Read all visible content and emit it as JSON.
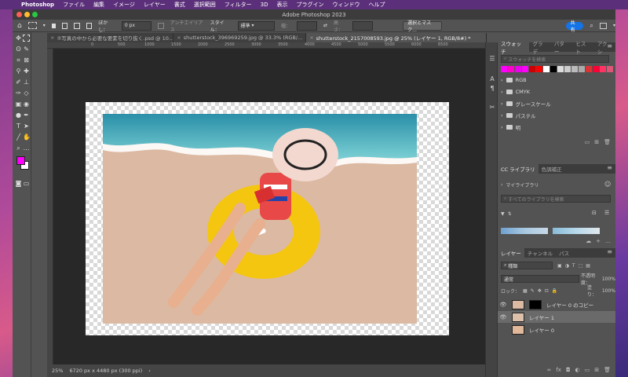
{
  "menubar": {
    "apple": "",
    "items": [
      "Photoshop",
      "ファイル",
      "編集",
      "イメージ",
      "レイヤー",
      "書式",
      "選択範囲",
      "フィルター",
      "3D",
      "表示",
      "プラグイン",
      "ウィンドウ",
      "ヘルプ"
    ]
  },
  "window": {
    "title": "Adobe Photoshop 2023"
  },
  "options": {
    "feather_label": "ぼかし：",
    "feather_value": "0 px",
    "antialias_label": "アンチエイリアス",
    "style_label": "スタイル：",
    "style_value": "標準",
    "width_label": "幅：",
    "height_label": "高さ：",
    "select_mask_button": "選択とマスク...",
    "share_button": "共有"
  },
  "tabs": [
    {
      "label": "②写真の中から必要な要素を切り抜く.psd @ 10...",
      "active": false
    },
    {
      "label": "shutterstock_396969259.jpg @ 33.3% (RGB/...",
      "active": false
    },
    {
      "label": "shutterstock_2157008593.jpg @ 25% (レイヤー 1, RGB/8#) *",
      "active": true
    }
  ],
  "ruler_ticks": [
    "0",
    "500",
    "1000",
    "1500",
    "2000",
    "2500",
    "3000",
    "3500",
    "4000",
    "4500",
    "5000",
    "5500",
    "6000",
    "6500"
  ],
  "status": {
    "zoom": "25%",
    "info": "6720 px x 4480 px (300 ppi)",
    "arrow": "›"
  },
  "swatches_panel": {
    "tabs": [
      "スウォッチ",
      "グラデ",
      "パター",
      "ヒスト",
      "アクシ"
    ],
    "search_placeholder": "スウォッチを検索",
    "colors": [
      "#ff00ff",
      "#ff00cc",
      "#ee00ee",
      "#ff00ff",
      "#cc0000",
      "#ff0000",
      "#ffffff",
      "#000000",
      "#dddddd",
      "#cccccc",
      "#bbbbbb",
      "#aaaaaa",
      "#dd3333",
      "#ff0033",
      "#ff3366",
      "#dd5577"
    ],
    "folders": [
      "RGB",
      "CMYK",
      "グレースケール",
      "パステル",
      "明"
    ]
  },
  "library_panel": {
    "tabs": [
      "CC ライブラリ",
      "色調補正"
    ],
    "library_name": "マイライブラリ",
    "search_placeholder": "すべてのライブラリを検索"
  },
  "layers_panel": {
    "tabs": [
      "レイヤー",
      "チャンネル",
      "パス"
    ],
    "filter_label": "種類",
    "blend_mode": "通常",
    "opacity_label": "不透明度：",
    "opacity_value": "100%",
    "lock_label": "ロック：",
    "fill_label": "塗り：",
    "fill_value": "100%",
    "layers": [
      {
        "name": "レイヤー 0 のコピー",
        "visible": true,
        "selected": false,
        "has_mask": true
      },
      {
        "name": "レイヤー 1",
        "visible": true,
        "selected": true,
        "has_mask": false
      },
      {
        "name": "レイヤー 0",
        "visible": false,
        "selected": false,
        "has_mask": false
      }
    ]
  },
  "colors": {
    "foreground": "#ff00ff",
    "background": "#ffffff",
    "accent": "#1473e6"
  }
}
